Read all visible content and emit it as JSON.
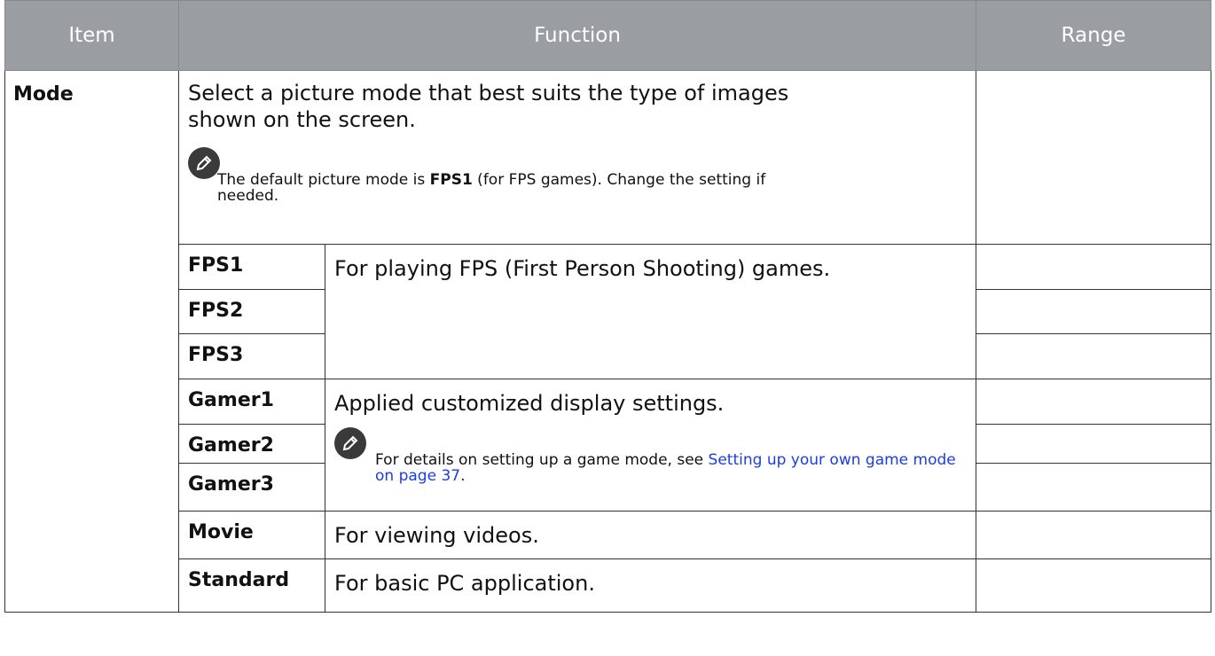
{
  "header": {
    "item": "Item",
    "function": "Function",
    "range": "Range"
  },
  "mode": {
    "label": "Mode",
    "description": "Select a picture mode that best suits the type of images shown on the screen.",
    "note_prefix": "The default picture mode is ",
    "note_bold": "FPS1",
    "note_suffix": " (for FPS games). Change the setting if needed."
  },
  "rows": {
    "fps1": "FPS1",
    "fps2": "FPS2",
    "fps3": "FPS3",
    "fps_desc": "For playing FPS (First Person Shooting) games.",
    "gamer1": "Gamer1",
    "gamer2": "Gamer2",
    "gamer3": "Gamer3",
    "gamer_desc": "Applied customized display settings.",
    "gamer_note": "For details on setting up a game mode, see ",
    "gamer_link": "Setting up your own game mode on page 37",
    "gamer_note_end": ".",
    "movie": "Movie",
    "movie_desc": "For viewing videos.",
    "standard": "Standard",
    "standard_desc": "For basic PC application."
  },
  "icons": {
    "note": "pencil-note-icon"
  }
}
